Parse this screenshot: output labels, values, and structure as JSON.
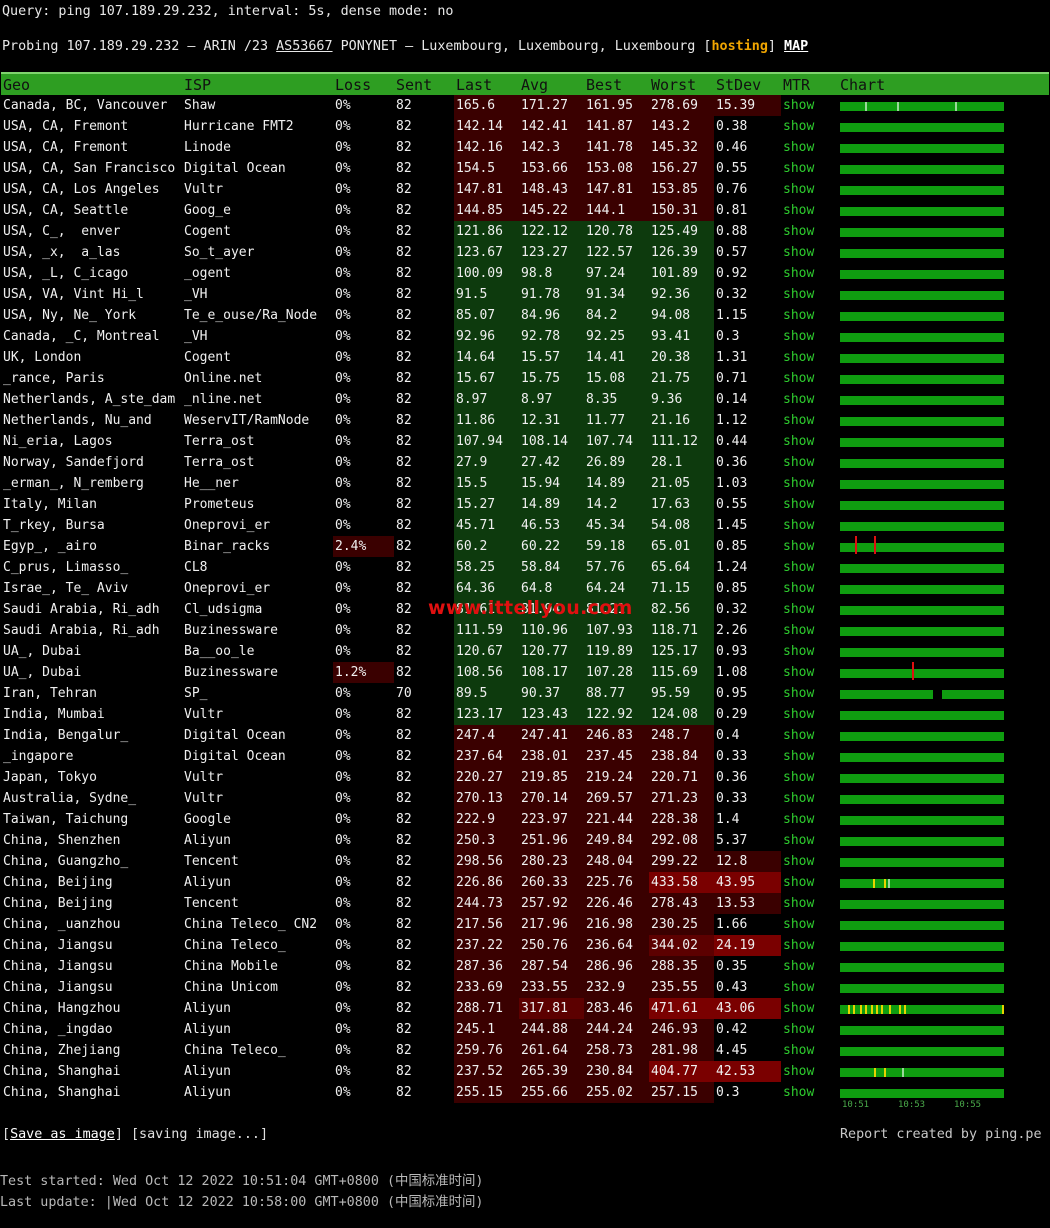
{
  "query_line": "Query: ping 107.189.29.232, interval: 5s, dense mode: no",
  "probe": {
    "prefix": "Probing 107.189.29.232 — ARIN /23 ",
    "asn": "AS53667",
    "middle": " PONYNET — Luxembourg, Luxembourg, Luxembourg [",
    "tag": "hosting",
    "close": "] ",
    "map": "MAP"
  },
  "headers": [
    "Geo",
    "ISP",
    "Loss",
    "Sent",
    "Last",
    "Avg",
    "Best",
    "Worst",
    "StDev",
    "MTR",
    "Chart"
  ],
  "mtr_label": "show",
  "rows": [
    [
      "Canada, BC, Vancouver",
      "Shaw",
      "0%",
      "82",
      "165.6",
      "171.27",
      "161.95",
      "278.69",
      "15.39"
    ],
    [
      "USA, CA, Fremont",
      "Hurricane FMT2",
      "0%",
      "82",
      "142.14",
      "142.41",
      "141.87",
      "143.2",
      "0.38"
    ],
    [
      "USA, CA, Fremont",
      "Linode",
      "0%",
      "82",
      "142.16",
      "142.3",
      "141.78",
      "145.32",
      "0.46"
    ],
    [
      "USA, CA, San Francisco",
      "Digital Ocean",
      "0%",
      "82",
      "154.5",
      "153.66",
      "153.08",
      "156.27",
      "0.55"
    ],
    [
      "USA, CA, Los Angeles",
      "Vultr",
      "0%",
      "82",
      "147.81",
      "148.43",
      "147.81",
      "153.85",
      "0.76"
    ],
    [
      "USA, CA, Seattle",
      "Goog_e",
      "0%",
      "82",
      "144.85",
      "145.22",
      "144.1",
      "150.31",
      "0.81"
    ],
    [
      "USA, C_,  enver",
      "Cogent",
      "0%",
      "82",
      "121.86",
      "122.12",
      "120.78",
      "125.49",
      "0.88"
    ],
    [
      "USA, _x,  a_las",
      "So_t_ayer",
      "0%",
      "82",
      "123.67",
      "123.27",
      "122.57",
      "126.39",
      "0.57"
    ],
    [
      "USA, _L, C_icago",
      "_ogent",
      "0%",
      "82",
      "100.09",
      "98.8",
      "97.24",
      "101.89",
      "0.92"
    ],
    [
      "USA, VA, Vint Hi_l",
      "_VH",
      "0%",
      "82",
      "91.5",
      "91.78",
      "91.34",
      "92.36",
      "0.32"
    ],
    [
      "USA, Ny, Ne_ York",
      "Te_e_ouse/Ra_Node",
      "0%",
      "82",
      "85.07",
      "84.96",
      "84.2",
      "94.08",
      "1.15"
    ],
    [
      "Canada, _C, Montreal",
      "_VH",
      "0%",
      "82",
      "92.96",
      "92.78",
      "92.25",
      "93.41",
      "0.3"
    ],
    [
      "UK, London",
      "Cogent",
      "0%",
      "82",
      "14.64",
      "15.57",
      "14.41",
      "20.38",
      "1.31"
    ],
    [
      "_rance, Paris",
      "Online.net",
      "0%",
      "82",
      "15.67",
      "15.75",
      "15.08",
      "21.75",
      "0.71"
    ],
    [
      "Netherlands, A_ste_dam",
      "_nline.net",
      "0%",
      "82",
      "8.97",
      "8.97",
      "8.35",
      "9.36",
      "0.14"
    ],
    [
      "Netherlands, Nu_and",
      "WeservIT/RamNode",
      "0%",
      "82",
      "11.86",
      "12.31",
      "11.77",
      "21.16",
      "1.12"
    ],
    [
      "Ni_eria, Lagos",
      "Terra_ost",
      "0%",
      "82",
      "107.94",
      "108.14",
      "107.74",
      "111.12",
      "0.44"
    ],
    [
      "Norway, Sandefjord",
      "Terra_ost",
      "0%",
      "82",
      "27.9",
      "27.42",
      "26.89",
      "28.1",
      "0.36"
    ],
    [
      "_erman_, N_remberg",
      "He__ner",
      "0%",
      "82",
      "15.5",
      "15.94",
      "14.89",
      "21.05",
      "1.03"
    ],
    [
      "Italy, Milan",
      "Prometeus",
      "0%",
      "82",
      "15.27",
      "14.89",
      "14.2",
      "17.63",
      "0.55"
    ],
    [
      "T_rkey, Bursa",
      "Oneprovi_er",
      "0%",
      "82",
      "45.71",
      "46.53",
      "45.34",
      "54.08",
      "1.45"
    ],
    [
      "Egyp_, _airo",
      "Binar_racks",
      "2.4%",
      "82",
      "60.2",
      "60.22",
      "59.18",
      "65.01",
      "0.85"
    ],
    [
      "C_prus, Limasso_",
      "CL8",
      "0%",
      "82",
      "58.25",
      "58.84",
      "57.76",
      "65.64",
      "1.24"
    ],
    [
      "Israe_, Te_ Aviv",
      "Oneprovi_er",
      "0%",
      "82",
      "64.36",
      "64.8",
      "64.24",
      "71.15",
      "0.85"
    ],
    [
      "Saudi Arabia, Ri_adh",
      "Cl_udsigma",
      "0%",
      "82",
      "81.61",
      "81.94",
      "81.21",
      "82.56",
      "0.32"
    ],
    [
      "Saudi Arabia, Ri_adh",
      "Buzinessware",
      "0%",
      "82",
      "111.59",
      "110.96",
      "107.93",
      "118.71",
      "2.26"
    ],
    [
      "UA_, Dubai",
      "Ba__oo_le",
      "0%",
      "82",
      "120.67",
      "120.77",
      "119.89",
      "125.17",
      "0.93"
    ],
    [
      "UA_, Dubai",
      "Buzinessware",
      "1.2%",
      "82",
      "108.56",
      "108.17",
      "107.28",
      "115.69",
      "1.08"
    ],
    [
      "Iran, Tehran",
      "SP_",
      "0%",
      "70",
      "89.5",
      "90.37",
      "88.77",
      "95.59",
      "0.95"
    ],
    [
      "India, Mumbai",
      "Vultr",
      "0%",
      "82",
      "123.17",
      "123.43",
      "122.92",
      "124.08",
      "0.29"
    ],
    [
      "India, Bengalur_",
      "Digital Ocean",
      "0%",
      "82",
      "247.4",
      "247.41",
      "246.83",
      "248.7",
      "0.4"
    ],
    [
      "_ingapore",
      "Digital Ocean",
      "0%",
      "82",
      "237.64",
      "238.01",
      "237.45",
      "238.84",
      "0.33"
    ],
    [
      "Japan, Tokyo",
      "Vultr",
      "0%",
      "82",
      "220.27",
      "219.85",
      "219.24",
      "220.71",
      "0.36"
    ],
    [
      "Australia, Sydne_",
      "Vultr",
      "0%",
      "82",
      "270.13",
      "270.14",
      "269.57",
      "271.23",
      "0.33"
    ],
    [
      "Taiwan, Taichung",
      "Google",
      "0%",
      "82",
      "222.9",
      "223.97",
      "221.44",
      "228.38",
      "1.4"
    ],
    [
      "China, Shenzhen",
      "Aliyun",
      "0%",
      "82",
      "250.3",
      "251.96",
      "249.84",
      "292.08",
      "5.37"
    ],
    [
      "China, Guangzho_",
      "Tencent",
      "0%",
      "82",
      "298.56",
      "280.23",
      "248.04",
      "299.22",
      "12.8"
    ],
    [
      "China, Beijing",
      "Aliyun",
      "0%",
      "82",
      "226.86",
      "260.33",
      "225.76",
      "433.58",
      "43.95"
    ],
    [
      "China, Beijing",
      "Tencent",
      "0%",
      "82",
      "244.73",
      "257.92",
      "226.46",
      "278.43",
      "13.53"
    ],
    [
      "China, _uanzhou",
      "China Teleco_ CN2",
      "0%",
      "82",
      "217.56",
      "217.96",
      "216.98",
      "230.25",
      "1.66"
    ],
    [
      "China, Jiangsu",
      "China Teleco_",
      "0%",
      "82",
      "237.22",
      "250.76",
      "236.64",
      "344.02",
      "24.19"
    ],
    [
      "China, Jiangsu",
      "China Mobile",
      "0%",
      "82",
      "287.36",
      "287.54",
      "286.96",
      "288.35",
      "0.35"
    ],
    [
      "China, Jiangsu",
      "China Unicom",
      "0%",
      "82",
      "233.69",
      "233.55",
      "232.9",
      "235.55",
      "0.43"
    ],
    [
      "China, Hangzhou",
      "Aliyun",
      "0%",
      "82",
      "288.71",
      "317.81",
      "283.46",
      "471.61",
      "43.06"
    ],
    [
      "China, _ingdao",
      "Aliyun",
      "0%",
      "82",
      "245.1",
      "244.88",
      "244.24",
      "246.93",
      "0.42"
    ],
    [
      "China, Zhejiang",
      "China Teleco_",
      "0%",
      "82",
      "259.76",
      "261.64",
      "258.73",
      "281.98",
      "4.45"
    ],
    [
      "China, Shanghai",
      "Aliyun",
      "0%",
      "82",
      "237.52",
      "265.39",
      "230.84",
      "404.77",
      "42.53"
    ],
    [
      "China, Shanghai",
      "Aliyun",
      "0%",
      "82",
      "255.15",
      "255.66",
      "255.02",
      "257.15",
      "0.3"
    ]
  ],
  "chart_marks": {
    "0": [
      {
        "pos": 0.15,
        "c": "#9ad89a"
      },
      {
        "pos": 0.35,
        "c": "#9ad89a"
      },
      {
        "pos": 0.7,
        "c": "#9ad89a"
      }
    ],
    "21": [
      {
        "pos": 0.09,
        "c": "#e01010",
        "tall": true
      },
      {
        "pos": 0.21,
        "c": "#e01010",
        "tall": true
      }
    ],
    "27": [
      {
        "pos": 0.44,
        "c": "#e01010",
        "tall": true
      }
    ],
    "28": [
      {
        "gap": [
          0.57,
          0.62
        ]
      }
    ],
    "37": [
      {
        "pos": 0.2,
        "c": "#e6d400"
      },
      {
        "pos": 0.27,
        "c": "#e6d400"
      },
      {
        "pos": 0.29,
        "c": "#9ad89a"
      }
    ],
    "43": [
      {
        "pos": 0.05,
        "c": "#e6d400"
      },
      {
        "pos": 0.08,
        "c": "#e6d400"
      },
      {
        "pos": 0.12,
        "c": "#e6d400"
      },
      {
        "pos": 0.15,
        "c": "#e6d400"
      },
      {
        "pos": 0.19,
        "c": "#e6d400"
      },
      {
        "pos": 0.22,
        "c": "#e6d400"
      },
      {
        "pos": 0.25,
        "c": "#e6d400"
      },
      {
        "pos": 0.3,
        "c": "#e6d400"
      },
      {
        "pos": 0.36,
        "c": "#e6d400"
      },
      {
        "pos": 0.39,
        "c": "#e6d400"
      },
      {
        "pos": 0.99,
        "c": "#e6d400"
      }
    ],
    "46": [
      {
        "pos": 0.21,
        "c": "#e6d400"
      },
      {
        "pos": 0.27,
        "c": "#e6d400"
      },
      {
        "pos": 0.38,
        "c": "#9ad89a"
      }
    ]
  },
  "chart_axis": [
    "10:51",
    "10:53",
    "10:55"
  ],
  "colors": {
    "green_cell": "#0d3a0d",
    "darkred_cell": "#3a0000",
    "red_cell": "#5c0000",
    "brightred_cell": "#7a0000"
  },
  "watermark": "www.ittellyou.com",
  "save_link": "Save as image",
  "saving": " [saving image...]",
  "report": "Report created by ping.pe",
  "test_started": "Test started: Wed Oct 12 2022 10:51:04 GMT+0800 (中国标准时间)",
  "last_update": "Last update: |Wed Oct 12 2022 10:58:00 GMT+0800 (中国标准时间)"
}
